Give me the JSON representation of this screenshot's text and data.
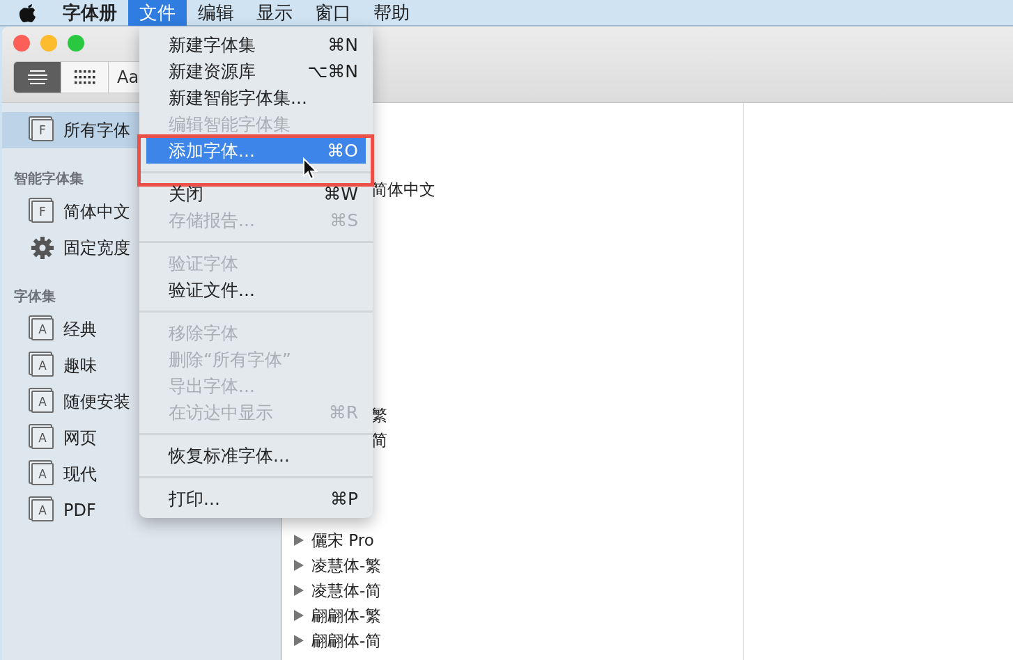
{
  "menu_bar": {
    "items": [
      {
        "label": "字体册",
        "kind": "app",
        "selected": false
      },
      {
        "label": "文件",
        "kind": "menu",
        "selected": true
      },
      {
        "label": "编辑",
        "kind": "menu",
        "selected": false
      },
      {
        "label": "显示",
        "kind": "menu",
        "selected": false
      },
      {
        "label": "窗口",
        "kind": "menu",
        "selected": false
      },
      {
        "label": "帮助",
        "kind": "menu",
        "selected": false
      }
    ]
  },
  "toolbar": {
    "view_buttons": [
      {
        "kind": "list",
        "selected": true
      },
      {
        "kind": "grid",
        "selected": false
      },
      {
        "kind": "sample",
        "label": "Aa",
        "selected": false
      }
    ]
  },
  "sidebar": {
    "sections": [
      {
        "items": [
          {
            "label": "所有字体",
            "icon_letter": "F",
            "kind": "collection",
            "selected": true
          }
        ]
      },
      {
        "header": "智能字体集",
        "items": [
          {
            "label": "简体中文",
            "icon_letter": "F",
            "kind": "collection",
            "selected": false
          },
          {
            "label": "固定宽度",
            "kind": "gear",
            "selected": false
          }
        ]
      },
      {
        "header": "字体集",
        "items": [
          {
            "label": "经典",
            "icon_letter": "A",
            "kind": "collection",
            "selected": false
          },
          {
            "label": "趣味",
            "icon_letter": "A",
            "kind": "collection",
            "selected": false
          },
          {
            "label": "随便安装",
            "icon_letter": "A",
            "kind": "collection",
            "selected": false
          },
          {
            "label": "网页",
            "icon_letter": "A",
            "kind": "collection",
            "selected": false
          },
          {
            "label": "现代",
            "icon_letter": "A",
            "kind": "collection",
            "selected": false
          },
          {
            "label": "PDF",
            "icon_letter": "A",
            "kind": "collection",
            "selected": false
          }
        ]
      }
    ]
  },
  "font_list": {
    "rows": [
      {
        "kind": "fragment",
        "label": "简体中文"
      },
      {
        "kind": "covered"
      },
      {
        "kind": "covered"
      },
      {
        "kind": "covered"
      },
      {
        "kind": "covered"
      },
      {
        "kind": "covered"
      },
      {
        "kind": "covered"
      },
      {
        "kind": "covered"
      },
      {
        "kind": "covered"
      },
      {
        "kind": "fragment",
        "label": "繁"
      },
      {
        "kind": "fragment",
        "label": "简"
      },
      {
        "kind": "covered"
      },
      {
        "kind": "covered"
      },
      {
        "kind": "covered"
      },
      {
        "kind": "family",
        "label": "儷宋 Pro"
      },
      {
        "kind": "family",
        "label": "凌慧体-繁"
      },
      {
        "kind": "family",
        "label": "凌慧体-简"
      },
      {
        "kind": "family",
        "label": "翩翩体-繁"
      },
      {
        "kind": "family",
        "label": "翩翩体-简"
      }
    ]
  },
  "file_menu": {
    "items": [
      {
        "kind": "item",
        "label": "新建字体集",
        "shortcut": "⌘N",
        "disabled": false,
        "selected": false
      },
      {
        "kind": "item",
        "label": "新建资源库",
        "shortcut": "⌥⌘N",
        "disabled": false,
        "selected": false
      },
      {
        "kind": "item",
        "label": "新建智能字体集...",
        "disabled": false,
        "selected": false
      },
      {
        "kind": "item",
        "label": "编辑智能字体集",
        "disabled": true,
        "selected": false
      },
      {
        "kind": "item",
        "label": "添加字体...",
        "shortcut": "⌘O",
        "disabled": false,
        "selected": true
      },
      {
        "kind": "separator"
      },
      {
        "kind": "item",
        "label": "关闭",
        "shortcut": "⌘W",
        "disabled": false,
        "selected": false
      },
      {
        "kind": "item",
        "label": "存储报告...",
        "shortcut": "⌘S",
        "disabled": true,
        "selected": false
      },
      {
        "kind": "separator"
      },
      {
        "kind": "item",
        "label": "验证字体",
        "disabled": true,
        "selected": false
      },
      {
        "kind": "item",
        "label": "验证文件...",
        "disabled": false,
        "selected": false
      },
      {
        "kind": "separator"
      },
      {
        "kind": "item",
        "label": "移除字体",
        "disabled": true,
        "selected": false
      },
      {
        "kind": "item",
        "label": "删除“所有字体”",
        "disabled": true,
        "selected": false
      },
      {
        "kind": "item",
        "label": "导出字体...",
        "disabled": true,
        "selected": false
      },
      {
        "kind": "item",
        "label": "在访达中显示",
        "shortcut": "⌘R",
        "disabled": true,
        "selected": false
      },
      {
        "kind": "separator"
      },
      {
        "kind": "item",
        "label": "恢复标准字体...",
        "disabled": false,
        "selected": false
      },
      {
        "kind": "separator"
      },
      {
        "kind": "item",
        "label": "打印...",
        "shortcut": "⌘P",
        "disabled": false,
        "selected": false
      }
    ]
  }
}
